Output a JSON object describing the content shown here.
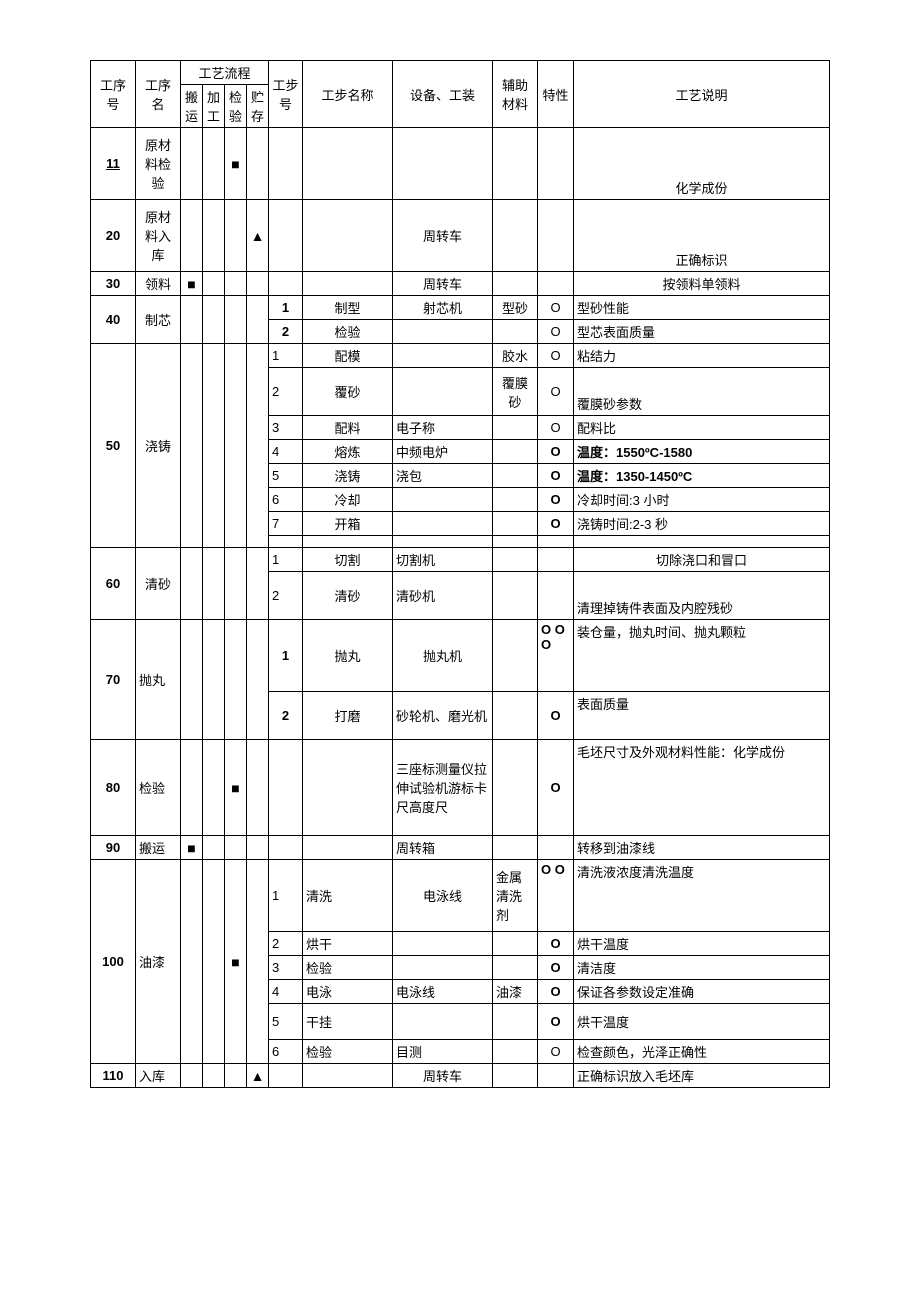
{
  "headers": {
    "procNo": "工序号",
    "procName": "工序名",
    "flowGroup": "工艺流程",
    "flowCols": [
      "搬运",
      "加工",
      "检验",
      "贮存"
    ],
    "stepNo": "工步号",
    "stepName": "工步名称",
    "equip": "设备、工装",
    "aux": "辅助材料",
    "char": "特性",
    "desc": "工艺说明"
  },
  "rows": [
    {
      "no": "11",
      "noBold": true,
      "noUnder": true,
      "name": "原材料检验",
      "flow": [
        false,
        false,
        "sq",
        false
      ],
      "steps": [
        {
          "sn": "",
          "sname": "",
          "equip": "",
          "aux": "",
          "char": "",
          "desc": "化学成份",
          "h": 3
        }
      ]
    },
    {
      "no": "20",
      "noBold": true,
      "name": "原材料入库",
      "flow": [
        false,
        false,
        false,
        "tr"
      ],
      "steps": [
        {
          "sn": "",
          "sname": "",
          "equip": "周转车",
          "aux": "",
          "char": "",
          "desc": "正确标识",
          "h": 3
        }
      ]
    },
    {
      "no": "30",
      "noBold": true,
      "name": "领料",
      "flow": [
        "sq",
        false,
        false,
        false
      ],
      "steps": [
        {
          "sn": "",
          "sname": "",
          "equip": "周转车",
          "aux": "",
          "char": "",
          "desc": "按领料单领料"
        }
      ]
    },
    {
      "no": "40",
      "noBold": true,
      "name": "制芯",
      "flow": [
        false,
        false,
        false,
        false
      ],
      "steps": [
        {
          "sn": "1",
          "snBold": true,
          "sname": "制型",
          "equip": "射芯机",
          "aux": "型砂",
          "char": "O",
          "desc": "型砂性能",
          "descLeft": true
        },
        {
          "sn": "2",
          "snBold": true,
          "sname": "检验",
          "equip": "",
          "aux": "",
          "char": "O",
          "desc": "型芯表面质量",
          "descLeft": true
        }
      ]
    },
    {
      "no": "50",
      "noBold": true,
      "name": "浇铸",
      "flow": [
        false,
        false,
        false,
        false
      ],
      "steps": [
        {
          "sn": "1",
          "sname": "配模",
          "equip": "",
          "aux": "胶水",
          "char": "O",
          "desc": "粘结力",
          "descLeft": true
        },
        {
          "sn": "2",
          "sname": "覆砂",
          "equip": "",
          "aux": "覆膜砂",
          "char": "O",
          "desc": "覆膜砂参数",
          "descLeft": true,
          "h": 2
        },
        {
          "sn": "3",
          "sname": "配料",
          "equip": "电子称",
          "equipLeft": true,
          "aux": "",
          "char": "O",
          "desc": "配料比",
          "descLeft": true
        },
        {
          "sn": "4",
          "sname": "熔炼",
          "equip": "中频电炉",
          "equipLeft": true,
          "aux": "",
          "char": "O",
          "charBold": true,
          "desc": "温度：1550ºC-1580",
          "descLeft": true,
          "descBold": true
        },
        {
          "sn": "5",
          "sname": "浇铸",
          "equip": "浇包",
          "equipLeft": true,
          "aux": "",
          "char": "O",
          "charBold": true,
          "desc": "温度：1350-1450ºC",
          "descLeft": true,
          "descBold": true
        },
        {
          "sn": "6",
          "sname": "冷却",
          "equip": "",
          "aux": "",
          "char": "O",
          "charBold": true,
          "desc": "冷却时间:3 小时",
          "descLeft": true
        },
        {
          "sn": "7",
          "sname": "开箱",
          "equip": "",
          "aux": "",
          "char": "O",
          "charBold": true,
          "desc": "浇铸时间:2-3 秒",
          "descLeft": true
        },
        {
          "sn": "",
          "sname": "",
          "equip": "",
          "aux": "",
          "char": "",
          "desc": "",
          "descLeft": true,
          "h": 0.5
        }
      ]
    },
    {
      "no": "60",
      "noBold": true,
      "name": "清砂",
      "flow": [
        false,
        false,
        false,
        false
      ],
      "steps": [
        {
          "sn": "1",
          "sname": "切割",
          "equip": "切割机",
          "equipLeft": true,
          "aux": "",
          "char": "",
          "desc": "切除浇口和冒口"
        },
        {
          "sn": "2",
          "sname": "清砂",
          "equip": "清砂机",
          "equipLeft": true,
          "aux": "",
          "char": "",
          "desc": "清理掉铸件表面及内腔残砂",
          "descLeft": true,
          "h": 2
        }
      ]
    },
    {
      "no": "70",
      "noBold": true,
      "name": "抛丸",
      "nameLeft": true,
      "flow": [
        false,
        false,
        false,
        false
      ],
      "steps": [
        {
          "sn": "1",
          "snBold": true,
          "sname": "抛丸",
          "equip": "抛丸机",
          "aux": "",
          "char": "O OO",
          "charBold": true,
          "charLeft": true,
          "desc": "装仓量，抛丸时间、抛丸颗粒",
          "descLeft": true,
          "h": 3
        },
        {
          "sn": "2",
          "snBold": true,
          "sname": "打磨",
          "equip": "砂轮机、磨光机",
          "equipLeft": true,
          "aux": "",
          "char": "O",
          "charBold": true,
          "desc": "表面质量",
          "descLeft": true,
          "h": 2
        }
      ]
    },
    {
      "no": "80",
      "noBold": true,
      "name": "检验",
      "nameLeft": true,
      "flow": [
        false,
        false,
        "sq",
        false
      ],
      "steps": [
        {
          "sn": "",
          "sname": "",
          "equip": "三座标测量仪拉伸试验机游标卡尺高度尺",
          "equipLeft": true,
          "aux": "",
          "char": "O",
          "charBold": true,
          "desc": "毛坯尺寸及外观材料性能：化学成份",
          "descLeft": true,
          "h": 4
        }
      ]
    },
    {
      "no": "90",
      "noBold": true,
      "name": "搬运",
      "nameLeft": true,
      "flow": [
        "sq",
        false,
        false,
        false
      ],
      "steps": [
        {
          "sn": "",
          "sname": "",
          "equip": "周转箱",
          "equipLeft": true,
          "aux": "",
          "char": "",
          "desc": "转移到油漆线",
          "descLeft": true
        }
      ]
    },
    {
      "no": "100",
      "noBold": true,
      "name": "油漆",
      "nameLeft": true,
      "flow": [
        false,
        false,
        "sq",
        false
      ],
      "steps": [
        {
          "sn": "1",
          "sname": "清洗",
          "snameLeft": true,
          "equip": "电泳线",
          "aux": "金属清洗剂",
          "auxLeft": true,
          "char": "O O",
          "charBold": true,
          "charLeft": true,
          "desc": "清洗液浓度清洗温度",
          "descLeft": true,
          "h": 3
        },
        {
          "sn": "2",
          "sname": "烘干",
          "snameLeft": true,
          "equip": "",
          "aux": "",
          "char": "O",
          "charBold": true,
          "desc": "烘干温度",
          "descLeft": true
        },
        {
          "sn": "3",
          "sname": "检验",
          "snameLeft": true,
          "equip": "",
          "aux": "",
          "char": "O",
          "charBold": true,
          "desc": "清洁度",
          "descLeft": true
        },
        {
          "sn": "4",
          "sname": "电泳",
          "snameLeft": true,
          "equip": "电泳线",
          "equipLeft": true,
          "aux": "油漆",
          "auxLeft": true,
          "char": "O",
          "charBold": true,
          "desc": "保证各参数设定准确",
          "descLeft": true
        },
        {
          "sn": "5",
          "sname": "干挂",
          "snameLeft": true,
          "equip": "",
          "aux": "",
          "char": "O",
          "charBold": true,
          "desc": "烘干温度",
          "descLeft": true,
          "h": 1.5
        },
        {
          "sn": "6",
          "sname": "检验",
          "snameLeft": true,
          "equip": "目测",
          "equipLeft": true,
          "aux": "",
          "char": "O",
          "desc": "检查颜色，光泽正确性",
          "descLeft": true
        }
      ]
    },
    {
      "no": "110",
      "noBold": true,
      "name": "入库",
      "nameLeft": true,
      "flow": [
        false,
        false,
        false,
        "tr"
      ],
      "steps": [
        {
          "sn": "",
          "sname": "",
          "equip": "周转车",
          "aux": "",
          "char": "",
          "desc": "正确标识放入毛坯库",
          "descLeft": true
        }
      ]
    }
  ]
}
